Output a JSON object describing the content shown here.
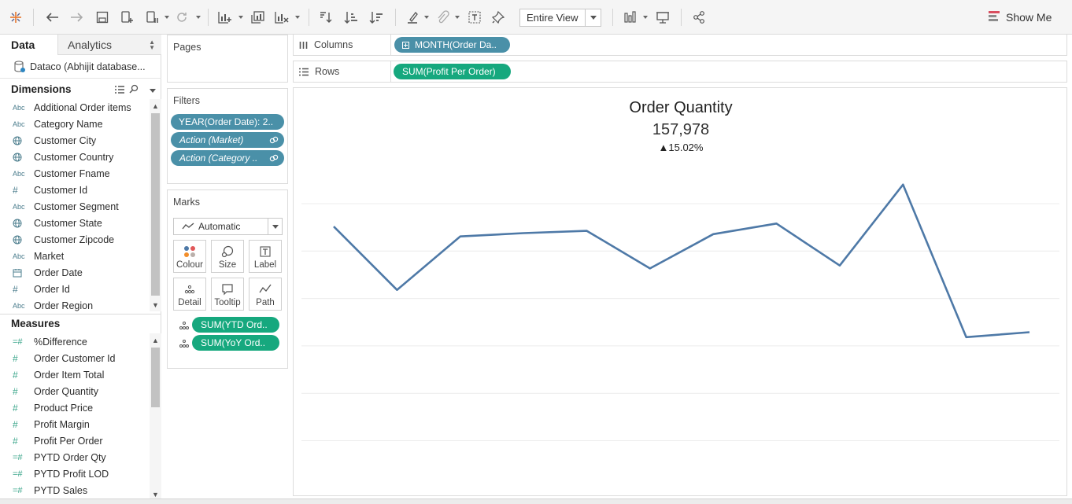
{
  "toolbar": {
    "icons": [
      "tableau-logo-icon",
      "undo-icon",
      "redo-icon",
      "save-icon",
      "new-datasource-icon",
      "pause-updates-icon",
      "refresh-icon",
      "new-worksheet-icon",
      "duplicate-icon",
      "clear-sheet-icon",
      "swap-icon",
      "sort-ascending-icon",
      "sort-descending-icon",
      "highlight-icon",
      "group-icon",
      "label-icon",
      "pin-icon",
      "chart-type-icon",
      "presentation-icon",
      "share-icon"
    ],
    "fit": "Entire View",
    "show_me": "Show Me"
  },
  "data_pane": {
    "tab_data": "Data",
    "tab_analytics": "Analytics",
    "datasource": "Dataco (Abhijit database...",
    "dimensions_title": "Dimensions",
    "measures_title": "Measures",
    "dimensions": [
      {
        "type": "Abc",
        "name": "Additional Order items"
      },
      {
        "type": "Abc",
        "name": "Category Name"
      },
      {
        "type": "geo",
        "name": "Customer City"
      },
      {
        "type": "geo",
        "name": "Customer Country"
      },
      {
        "type": "Abc",
        "name": "Customer Fname"
      },
      {
        "type": "#",
        "name": "Customer Id"
      },
      {
        "type": "Abc",
        "name": "Customer Segment"
      },
      {
        "type": "geo",
        "name": "Customer State"
      },
      {
        "type": "geo",
        "name": "Customer Zipcode"
      },
      {
        "type": "Abc",
        "name": "Market"
      },
      {
        "type": "date",
        "name": "Order Date"
      },
      {
        "type": "#",
        "name": "Order Id"
      },
      {
        "type": "Abc",
        "name": "Order Region"
      }
    ],
    "measures": [
      {
        "type": "=#",
        "name": "%Difference"
      },
      {
        "type": "#",
        "name": "Order Customer Id"
      },
      {
        "type": "#",
        "name": "Order Item Total"
      },
      {
        "type": "#",
        "name": "Order Quantity"
      },
      {
        "type": "#",
        "name": "Product Price"
      },
      {
        "type": "#",
        "name": "Profit Margin"
      },
      {
        "type": "#",
        "name": "Profit Per Order"
      },
      {
        "type": "=#",
        "name": "PYTD Order Qty"
      },
      {
        "type": "=#",
        "name": "PYTD Profit LOD"
      },
      {
        "type": "=#",
        "name": "PYTD Sales"
      }
    ]
  },
  "cards": {
    "pages_title": "Pages",
    "filters_title": "Filters",
    "filters": [
      {
        "label": "YEAR(Order Date): 2..",
        "italic": false
      },
      {
        "label": "Action (Market)",
        "italic": true
      },
      {
        "label": "Action (Category ..",
        "italic": true
      }
    ],
    "marks_title": "Marks",
    "mark_type": "Automatic",
    "mark_buttons": [
      "Colour",
      "Size",
      "Label",
      "Detail",
      "Tooltip",
      "Path"
    ],
    "mark_pills": [
      "SUM(YTD Ord..",
      "SUM(YoY Ord.."
    ]
  },
  "shelves": {
    "columns_label": "Columns",
    "columns_pill": "MONTH(Order Da..",
    "rows_label": "Rows",
    "rows_pill": "SUM(Profit Per Order)"
  },
  "view": {
    "title": "Order Quantity",
    "value": "157,978",
    "change": "▲15.02%",
    "line_color": "#4e79a7"
  },
  "chart_data": {
    "type": "line",
    "title": "Order Quantity",
    "x": [
      1,
      2,
      3,
      4,
      5,
      6,
      7,
      8,
      9,
      10,
      11,
      12
    ],
    "values": [
      0.795,
      0.603,
      0.765,
      0.775,
      0.782,
      0.668,
      0.772,
      0.804,
      0.677,
      0.922,
      0.46,
      0.475
    ],
    "ylim": [
      0,
      1
    ],
    "grid": true,
    "xlabel": "",
    "ylabel": ""
  }
}
